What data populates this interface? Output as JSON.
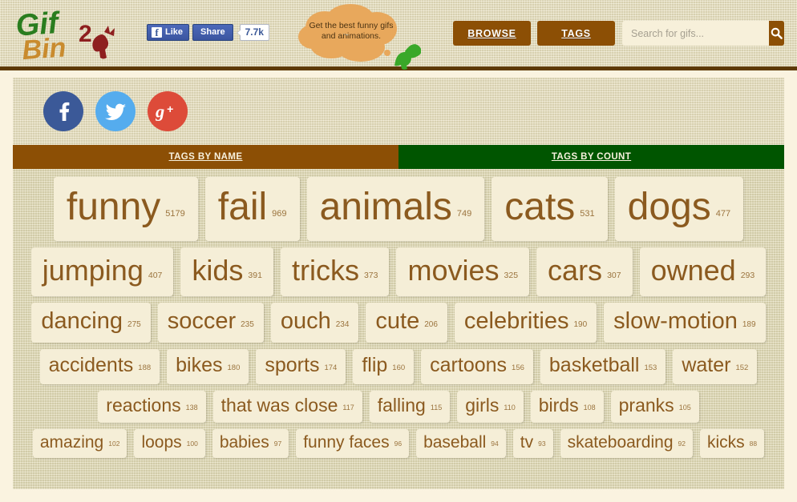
{
  "header": {
    "logo": {
      "part1": "Gif",
      "part2": "Bin",
      "alt": "gifbin-logo"
    },
    "facebook": {
      "like_label": "Like",
      "share_label": "Share",
      "count": "7.7k"
    },
    "bubble_text": "Get the best funny gifs and animations.",
    "nav": {
      "browse": "BROWSE",
      "tags": "TAGS"
    },
    "search": {
      "placeholder": "Search for gifs...",
      "value": "",
      "icon": "search-icon"
    }
  },
  "social": {
    "buttons": [
      {
        "name": "facebook",
        "glyph": "f",
        "color": "#3b5998"
      },
      {
        "name": "twitter",
        "glyph": "bird",
        "color": "#55acee"
      },
      {
        "name": "googleplus",
        "glyph": "g+",
        "color": "#dd4b39"
      }
    ]
  },
  "tabs": [
    {
      "label": "TAGS BY NAME",
      "color": "#8c4f05",
      "active": false
    },
    {
      "label": "TAGS BY COUNT",
      "color": "#005500",
      "active": true
    }
  ],
  "colors": {
    "page_bg": "#faf3e0",
    "texture_bg": "#e8e0bd",
    "cloud_bg": "#e3dcb6",
    "tag_bg": "#f5eed7",
    "tag_text": "#8b5a1f",
    "brown": "#8c4f05",
    "green": "#005500",
    "bubble": "#e8a85c"
  },
  "tag_cloud": {
    "rows": [
      [
        {
          "label": "funny",
          "count": "5179",
          "size": "s1"
        },
        {
          "label": "fail",
          "count": "969",
          "size": "s1"
        },
        {
          "label": "animals",
          "count": "749",
          "size": "s1"
        },
        {
          "label": "cats",
          "count": "531",
          "size": "s1"
        },
        {
          "label": "dogs",
          "count": "477",
          "size": "s1"
        }
      ],
      [
        {
          "label": "jumping",
          "count": "407",
          "size": "s2"
        },
        {
          "label": "kids",
          "count": "391",
          "size": "s2"
        },
        {
          "label": "tricks",
          "count": "373",
          "size": "s2"
        },
        {
          "label": "movies",
          "count": "325",
          "size": "s2"
        },
        {
          "label": "cars",
          "count": "307",
          "size": "s2"
        },
        {
          "label": "owned",
          "count": "293",
          "size": "s2"
        }
      ],
      [
        {
          "label": "dancing",
          "count": "275",
          "size": "s3"
        },
        {
          "label": "soccer",
          "count": "235",
          "size": "s3"
        },
        {
          "label": "ouch",
          "count": "234",
          "size": "s3"
        },
        {
          "label": "cute",
          "count": "206",
          "size": "s3"
        },
        {
          "label": "celebrities",
          "count": "190",
          "size": "s3"
        },
        {
          "label": "slow-motion",
          "count": "189",
          "size": "s3"
        }
      ],
      [
        {
          "label": "accidents",
          "count": "188",
          "size": "s4"
        },
        {
          "label": "bikes",
          "count": "180",
          "size": "s4"
        },
        {
          "label": "sports",
          "count": "174",
          "size": "s4"
        },
        {
          "label": "flip",
          "count": "160",
          "size": "s4"
        },
        {
          "label": "cartoons",
          "count": "156",
          "size": "s4"
        },
        {
          "label": "basketball",
          "count": "153",
          "size": "s4"
        },
        {
          "label": "water",
          "count": "152",
          "size": "s4"
        }
      ],
      [
        {
          "label": "reactions",
          "count": "138",
          "size": "s5"
        },
        {
          "label": "that was close",
          "count": "117",
          "size": "s5"
        },
        {
          "label": "falling",
          "count": "115",
          "size": "s5"
        },
        {
          "label": "girls",
          "count": "110",
          "size": "s5"
        },
        {
          "label": "birds",
          "count": "108",
          "size": "s5"
        },
        {
          "label": "pranks",
          "count": "105",
          "size": "s5"
        }
      ],
      [
        {
          "label": "amazing",
          "count": "102",
          "size": "s6"
        },
        {
          "label": "loops",
          "count": "100",
          "size": "s6"
        },
        {
          "label": "babies",
          "count": "97",
          "size": "s6"
        },
        {
          "label": "funny faces",
          "count": "96",
          "size": "s6"
        },
        {
          "label": "baseball",
          "count": "94",
          "size": "s6"
        },
        {
          "label": "tv",
          "count": "93",
          "size": "s6"
        },
        {
          "label": "skateboarding",
          "count": "92",
          "size": "s6"
        },
        {
          "label": "kicks",
          "count": "88",
          "size": "s6"
        }
      ]
    ]
  }
}
